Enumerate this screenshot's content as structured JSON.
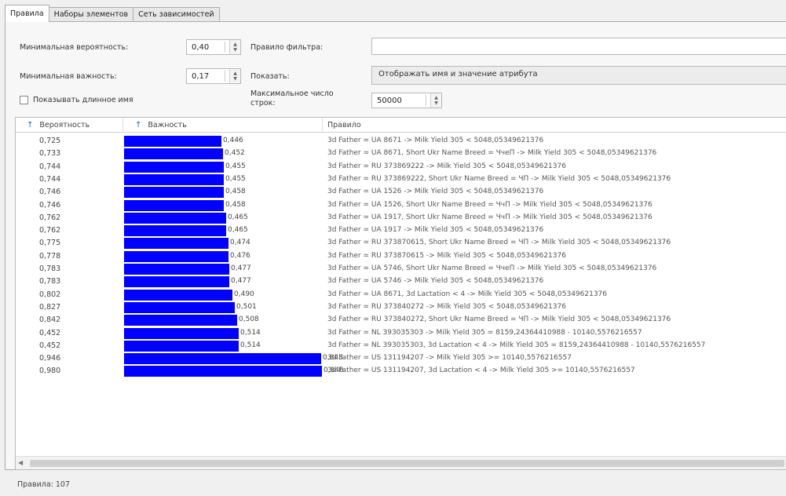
{
  "tabs": [
    "Правила",
    "Наборы элементов",
    "Сеть зависимостей"
  ],
  "controls": {
    "min_probability_label": "Минимальная вероятность:",
    "min_probability_value": "0,40",
    "min_importance_label": "Минимальная важность:",
    "min_importance_value": "0,17",
    "show_long_name_label": "Показывать длинное имя",
    "show_long_name_checked": false,
    "rule_filter_label": "Правило фильтра:",
    "rule_filter_value": "",
    "show_label": "Показать:",
    "show_value": "Отображать имя и значение атрибута",
    "max_rows_label": "Максимальное число строк:",
    "max_rows_value": "50000"
  },
  "table": {
    "columns": [
      "Вероятность",
      "Важность",
      "Правило"
    ],
    "bar_color": "#0000ff",
    "rows": [
      {
        "probability": "0,725",
        "importance": "0,446",
        "rule": "3d Father = UA 8671 -> Milk Yield 305 < 5048,05349621376"
      },
      {
        "probability": "0,733",
        "importance": "0,452",
        "rule": "3d Father = UA 8671, Short Ukr Name Breed = ЧчеП -> Milk Yield 305 < 5048,05349621376"
      },
      {
        "probability": "0,744",
        "importance": "0,455",
        "rule": "3d Father = RU 373869222 -> Milk Yield 305 < 5048,05349621376"
      },
      {
        "probability": "0,744",
        "importance": "0,455",
        "rule": "3d Father = RU 373869222, Short Ukr Name Breed = ЧП -> Milk Yield 305 < 5048,05349621376"
      },
      {
        "probability": "0,746",
        "importance": "0,458",
        "rule": "3d Father = UA 1526 -> Milk Yield 305 < 5048,05349621376"
      },
      {
        "probability": "0,746",
        "importance": "0,458",
        "rule": "3d Father = UA 1526, Short Ukr Name Breed = ЧчП -> Milk Yield 305 < 5048,05349621376"
      },
      {
        "probability": "0,762",
        "importance": "0,465",
        "rule": "3d Father = UA 1917, Short Ukr Name Breed = ЧчП -> Milk Yield 305 < 5048,05349621376"
      },
      {
        "probability": "0,762",
        "importance": "0,465",
        "rule": "3d Father = UA 1917 -> Milk Yield 305 < 5048,05349621376"
      },
      {
        "probability": "0,775",
        "importance": "0,474",
        "rule": "3d Father = RU 373870615, Short Ukr Name Breed = ЧП -> Milk Yield 305 < 5048,05349621376"
      },
      {
        "probability": "0,778",
        "importance": "0,476",
        "rule": "3d Father = RU 373870615 -> Milk Yield 305 < 5048,05349621376"
      },
      {
        "probability": "0,783",
        "importance": "0,477",
        "rule": "3d Father = UA 5746, Short Ukr Name Breed = ЧчеП -> Milk Yield 305 < 5048,05349621376"
      },
      {
        "probability": "0,783",
        "importance": "0,477",
        "rule": "3d Father = UA 5746 -> Milk Yield 305 < 5048,05349621376"
      },
      {
        "probability": "0,802",
        "importance": "0,490",
        "rule": "3d Father = UA 8671, 3d Lactation < 4 -> Milk Yield 305 < 5048,05349621376"
      },
      {
        "probability": "0,827",
        "importance": "0,501",
        "rule": "3d Father = RU 373840272 -> Milk Yield 305 < 5048,05349621376"
      },
      {
        "probability": "0,842",
        "importance": "0,508",
        "rule": "3d Father = RU 373840272, Short Ukr Name Breed = ЧП -> Milk Yield 305 < 5048,05349621376"
      },
      {
        "probability": "0,452",
        "importance": "0,514",
        "rule": "3d Father = NL 393035303 -> Milk Yield 305 = 8159,24364410988 - 10140,5576216557"
      },
      {
        "probability": "0,452",
        "importance": "0,514",
        "rule": "3d Father = NL 393035303, 3d Lactation < 4 -> Milk Yield 305 = 8159,24364410988 - 10140,5576216557"
      },
      {
        "probability": "0,946",
        "importance": "0,843",
        "rule": "3d Father = US 131194207 -> Milk Yield 305 >= 10140,5576216557"
      },
      {
        "probability": "0,980",
        "importance": "0,846",
        "rule": "3d Father = US 131194207, 3d Lactation < 4 -> Milk Yield 305 >= 10140,5576216557"
      }
    ]
  },
  "status": "Правила: 107"
}
